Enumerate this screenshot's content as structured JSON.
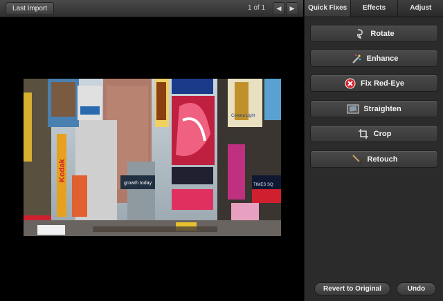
{
  "toolbar": {
    "last_import_label": "Last Import",
    "counter": "1 of 1",
    "prev_icon": "arrow-left-icon",
    "next_icon": "arrow-right-icon"
  },
  "tabs": [
    {
      "label": "Quick Fixes",
      "active": true
    },
    {
      "label": "Effects",
      "active": false
    },
    {
      "label": "Adjust",
      "active": false
    }
  ],
  "quick_fixes": [
    {
      "label": "Rotate",
      "icon": "rotate-icon"
    },
    {
      "label": "Enhance",
      "icon": "magic-wand-icon"
    },
    {
      "label": "Fix Red-Eye",
      "icon": "red-eye-icon"
    },
    {
      "label": "Straighten",
      "icon": "straighten-icon"
    },
    {
      "label": "Crop",
      "icon": "crop-icon"
    },
    {
      "label": "Retouch",
      "icon": "brush-icon"
    }
  ],
  "footer": {
    "revert_label": "Revert to Original",
    "undo_label": "Undo"
  },
  "photo": {
    "billboards": [
      "Kodak",
      "Corona Light",
      "growth today",
      "TIMES SQ"
    ]
  },
  "colors": {
    "panel_bg": "#2b2b2b",
    "red_eye": "#d8202a"
  }
}
